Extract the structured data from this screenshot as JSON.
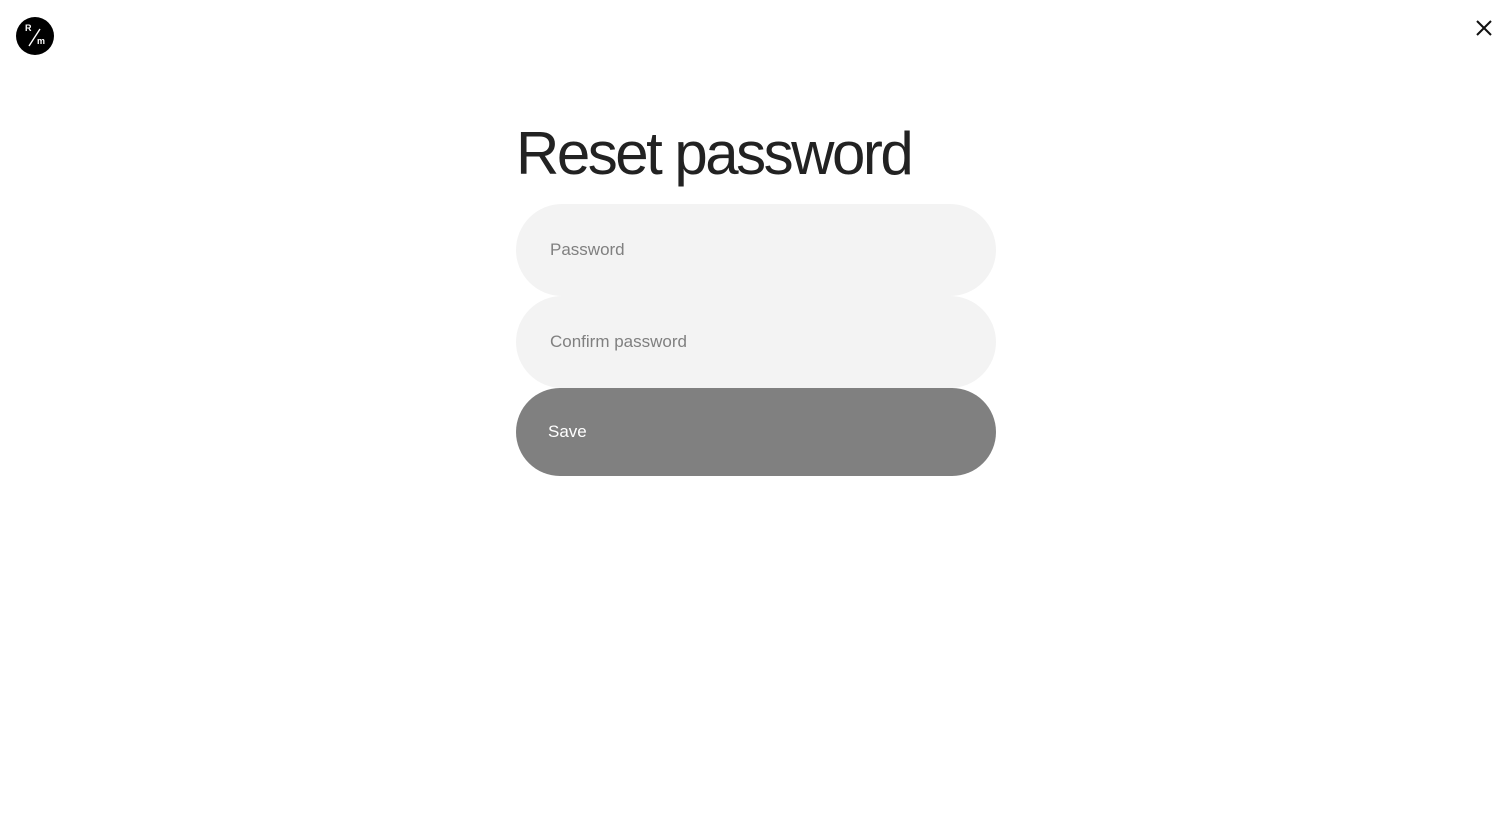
{
  "logo": {
    "top_letter": "R",
    "bottom_letter": "m",
    "icon": "rm-monogram-logo"
  },
  "header": {
    "close_icon": "close-icon"
  },
  "form": {
    "title": "Reset password",
    "password_placeholder": "Password",
    "password_value": "",
    "confirm_placeholder": "Confirm password",
    "confirm_value": "",
    "save_label": "Save"
  },
  "colors": {
    "text": "#222222",
    "field_background": "#f3f3f3",
    "placeholder": "#808080",
    "button_background": "#808080",
    "button_text": "#ffffff",
    "logo_background": "#000000"
  }
}
